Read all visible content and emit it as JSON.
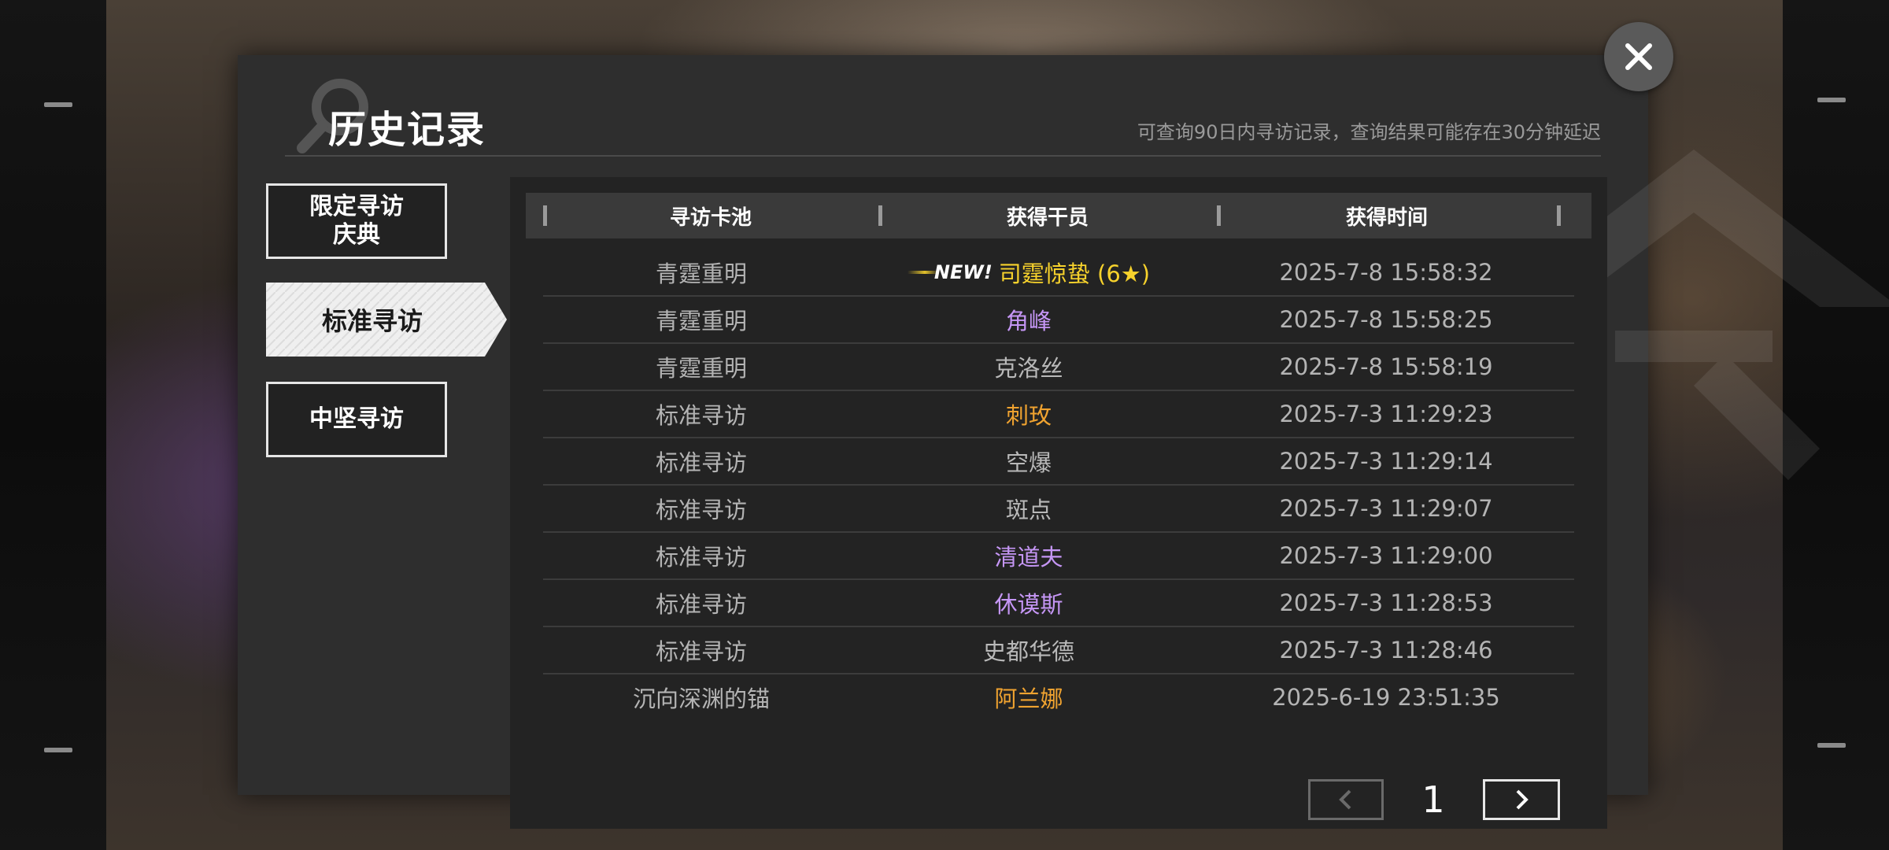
{
  "header": {
    "title": "历史记录",
    "subtitle": "可查询90日内寻访记录，查询结果可能存在30分钟延迟"
  },
  "menu": {
    "items": [
      {
        "label_line1": "限定寻访",
        "label_line2": "庆典",
        "active": false
      },
      {
        "label": "标准寻访",
        "active": true
      },
      {
        "label": "中坚寻访",
        "active": false
      }
    ]
  },
  "table": {
    "columns": [
      "寻访卡池",
      "获得干员",
      "获得时间"
    ],
    "new_badge": "NEW!",
    "rows": [
      {
        "pool": "青霆重明",
        "operator": "司霆惊蛰 (6★)",
        "time": "2025-7-8 15:58:32",
        "rarity_color": "#f7d22c",
        "is_new": true
      },
      {
        "pool": "青霆重明",
        "operator": "角峰",
        "time": "2025-7-8 15:58:25",
        "rarity_color": "#c596f5",
        "is_new": false
      },
      {
        "pool": "青霆重明",
        "operator": "克洛丝",
        "time": "2025-7-8 15:58:19",
        "rarity_color": "#b9b9b9",
        "is_new": false
      },
      {
        "pool": "标准寻访",
        "operator": "刺玫",
        "time": "2025-7-3 11:29:23",
        "rarity_color": "#f0a330",
        "is_new": false
      },
      {
        "pool": "标准寻访",
        "operator": "空爆",
        "time": "2025-7-3 11:29:14",
        "rarity_color": "#b9b9b9",
        "is_new": false
      },
      {
        "pool": "标准寻访",
        "operator": "斑点",
        "time": "2025-7-3 11:29:07",
        "rarity_color": "#b9b9b9",
        "is_new": false
      },
      {
        "pool": "标准寻访",
        "operator": "清道夫",
        "time": "2025-7-3 11:29:00",
        "rarity_color": "#c596f5",
        "is_new": false
      },
      {
        "pool": "标准寻访",
        "operator": "休谟斯",
        "time": "2025-7-3 11:28:53",
        "rarity_color": "#c596f5",
        "is_new": false
      },
      {
        "pool": "标准寻访",
        "operator": "史都华德",
        "time": "2025-7-3 11:28:46",
        "rarity_color": "#b9b9b9",
        "is_new": false
      },
      {
        "pool": "沉向深渊的锚",
        "operator": "阿兰娜",
        "time": "2025-6-19 23:51:35",
        "rarity_color": "#f0a330",
        "is_new": false
      }
    ]
  },
  "pagination": {
    "current_page": "1"
  },
  "icons": {
    "close": "close-icon",
    "prev": "chevron-left-icon",
    "next": "chevron-right-icon",
    "search": "magnifier-icon"
  }
}
